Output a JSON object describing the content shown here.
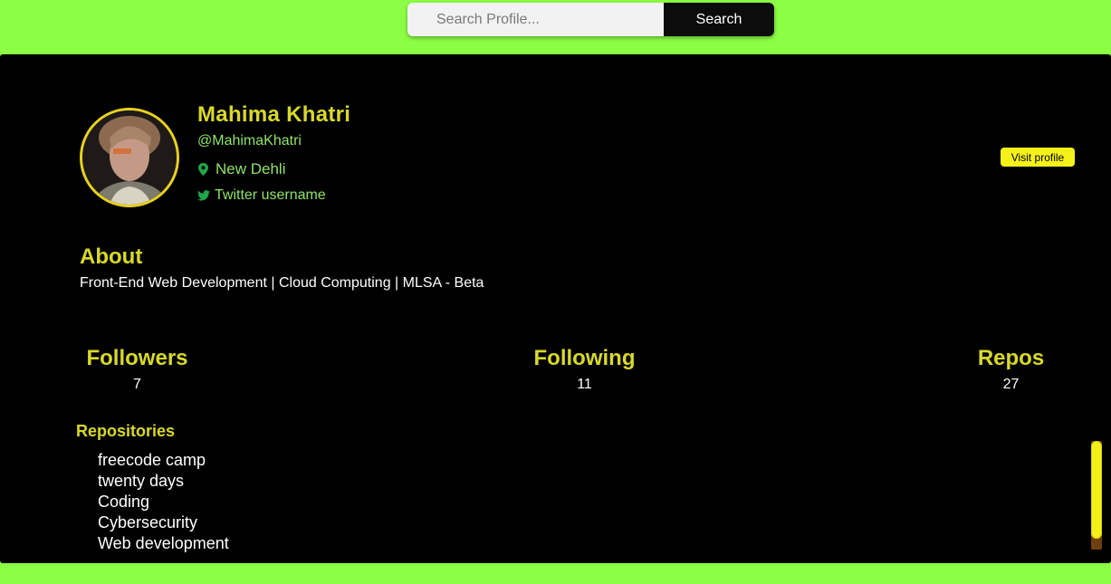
{
  "search": {
    "placeholder": "Search Profile...",
    "value": "",
    "button_label": "Search"
  },
  "profile": {
    "name": "Mahima Khatri",
    "handle": "@MahimaKhatri",
    "location": "New Dehli",
    "twitter": "Twitter username",
    "visit_label": "Visit profile",
    "avatar_icon": "avatar-photo"
  },
  "about": {
    "title": "About",
    "text": "Front-End Web Development | Cloud Computing | MLSA - Beta"
  },
  "stats": {
    "followers": {
      "label": "Followers",
      "value": "7"
    },
    "following": {
      "label": "Following",
      "value": "11"
    },
    "repos": {
      "label": "Repos",
      "value": "27"
    }
  },
  "repositories": {
    "title": "Repositories",
    "items": [
      "freecode camp",
      "twenty days",
      "Coding",
      "Cybersecurity",
      "Web development"
    ]
  },
  "colors": {
    "page_bg": "#8cff45",
    "card_bg": "#000000",
    "accent_yellow": "#d9d92b",
    "link_green": "#8fe36a",
    "button_yellow": "#f5f21a"
  }
}
